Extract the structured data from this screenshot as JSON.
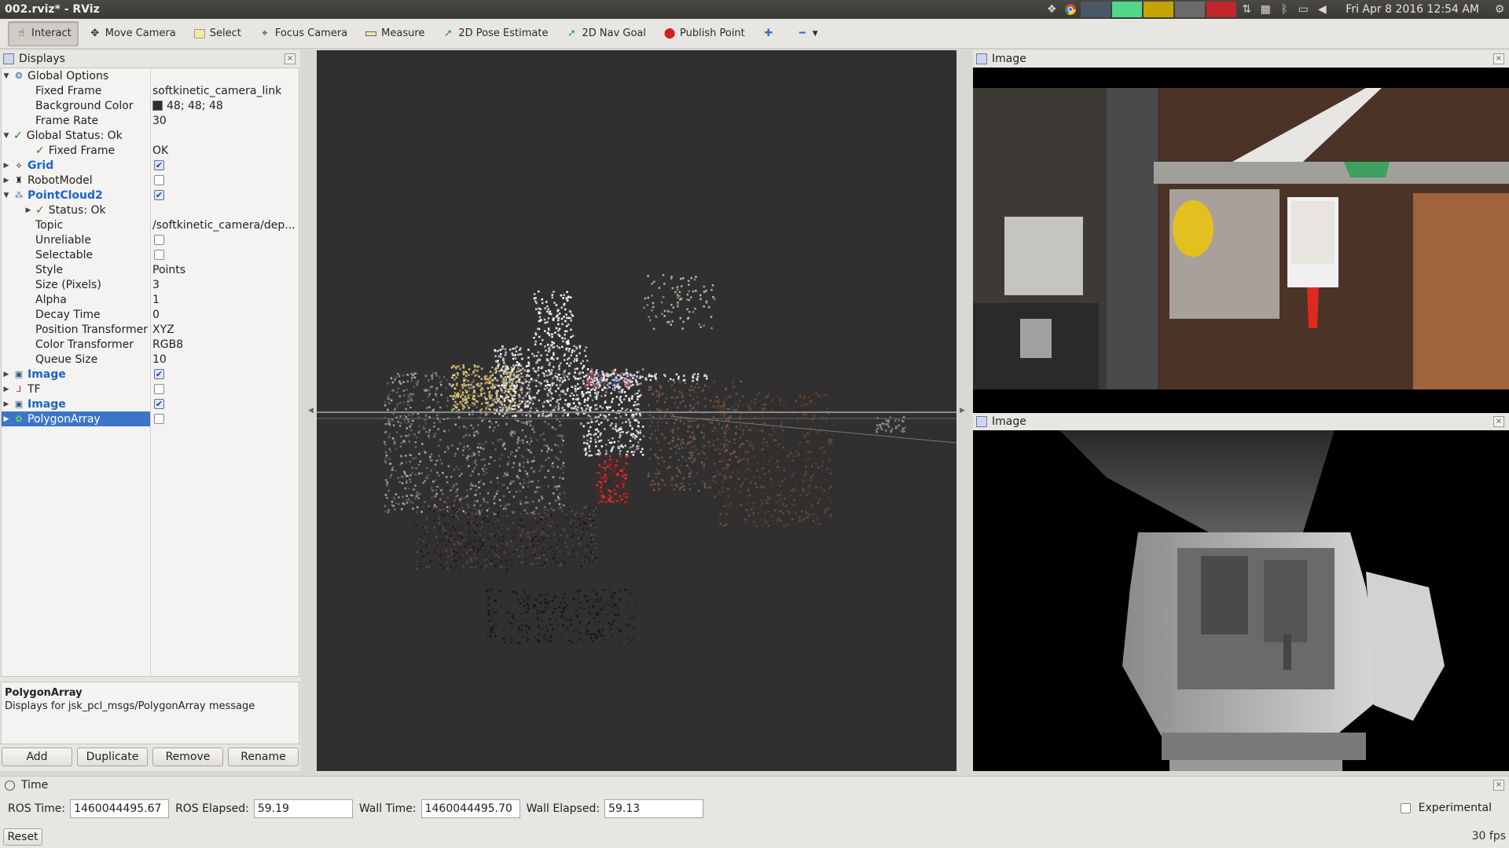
{
  "window": {
    "title": "002.rviz* - RViz"
  },
  "system_tray": {
    "clock": "Fri Apr  8 2016 12:54 AM",
    "swatches": [
      "#4a5866",
      "#52d68a",
      "#c4a400",
      "#6a6a6a",
      "#c0262a"
    ]
  },
  "toolbar": {
    "tools": [
      {
        "label": "Interact",
        "icon": "pointer-icon"
      },
      {
        "label": "Move Camera",
        "icon": "move-icon"
      },
      {
        "label": "Select",
        "icon": "select-box-icon"
      },
      {
        "label": "Focus Camera",
        "icon": "crosshair-icon"
      },
      {
        "label": "Measure",
        "icon": "ruler-icon"
      },
      {
        "label": "2D Pose Estimate",
        "icon": "green-arrow-icon"
      },
      {
        "label": "2D Nav Goal",
        "icon": "green-arrow-icon"
      },
      {
        "label": "Publish Point",
        "icon": "map-pin-icon"
      }
    ]
  },
  "displays": {
    "title": "Displays",
    "rows": [
      {
        "label": "Global Options",
        "value": ""
      },
      {
        "label": "Fixed Frame",
        "value": "softkinetic_camera_link"
      },
      {
        "label": "Background Color",
        "value": "48; 48; 48"
      },
      {
        "label": "Frame Rate",
        "value": "30"
      },
      {
        "label": "Global Status: Ok",
        "value": ""
      },
      {
        "label": "Fixed Frame",
        "value": "OK"
      },
      {
        "label": "Grid",
        "value": ""
      },
      {
        "label": "RobotModel",
        "value": ""
      },
      {
        "label": "PointCloud2",
        "value": ""
      },
      {
        "label": "Status: Ok",
        "value": ""
      },
      {
        "label": "Topic",
        "value": "/softkinetic_camera/dep..."
      },
      {
        "label": "Unreliable",
        "value": ""
      },
      {
        "label": "Selectable",
        "value": ""
      },
      {
        "label": "Style",
        "value": "Points"
      },
      {
        "label": "Size (Pixels)",
        "value": "3"
      },
      {
        "label": "Alpha",
        "value": "1"
      },
      {
        "label": "Decay Time",
        "value": "0"
      },
      {
        "label": "Position Transformer",
        "value": "XYZ"
      },
      {
        "label": "Color Transformer",
        "value": "RGB8"
      },
      {
        "label": "Queue Size",
        "value": "10"
      },
      {
        "label": "Image",
        "value": ""
      },
      {
        "label": "TF",
        "value": ""
      },
      {
        "label": "Image",
        "value": ""
      },
      {
        "label": "PolygonArray",
        "value": ""
      }
    ],
    "checkboxes": {
      "grid": true,
      "robotmodel": false,
      "pointcloud2": true,
      "unreliable": false,
      "selectable": false,
      "image1": true,
      "tf": false,
      "image2": true,
      "polygonarray": false
    },
    "background_color": "#303030",
    "description_title": "PolygonArray",
    "description_text": "Displays for jsk_pcl_msgs/PolygonArray message",
    "buttons": {
      "add": "Add",
      "duplicate": "Duplicate",
      "remove": "Remove",
      "rename": "Rename"
    }
  },
  "image_panels": {
    "top_title": "Image",
    "bottom_title": "Image"
  },
  "time": {
    "title": "Time",
    "ros_time_label": "ROS Time:",
    "ros_time": "1460044495.67",
    "ros_elapsed_label": "ROS Elapsed:",
    "ros_elapsed": "59.19",
    "wall_time_label": "Wall Time:",
    "wall_time": "1460044495.70",
    "wall_elapsed_label": "Wall Elapsed:",
    "wall_elapsed": "59.13",
    "experimental_label": "Experimental",
    "reset_label": "Reset",
    "fps": "30 fps"
  }
}
